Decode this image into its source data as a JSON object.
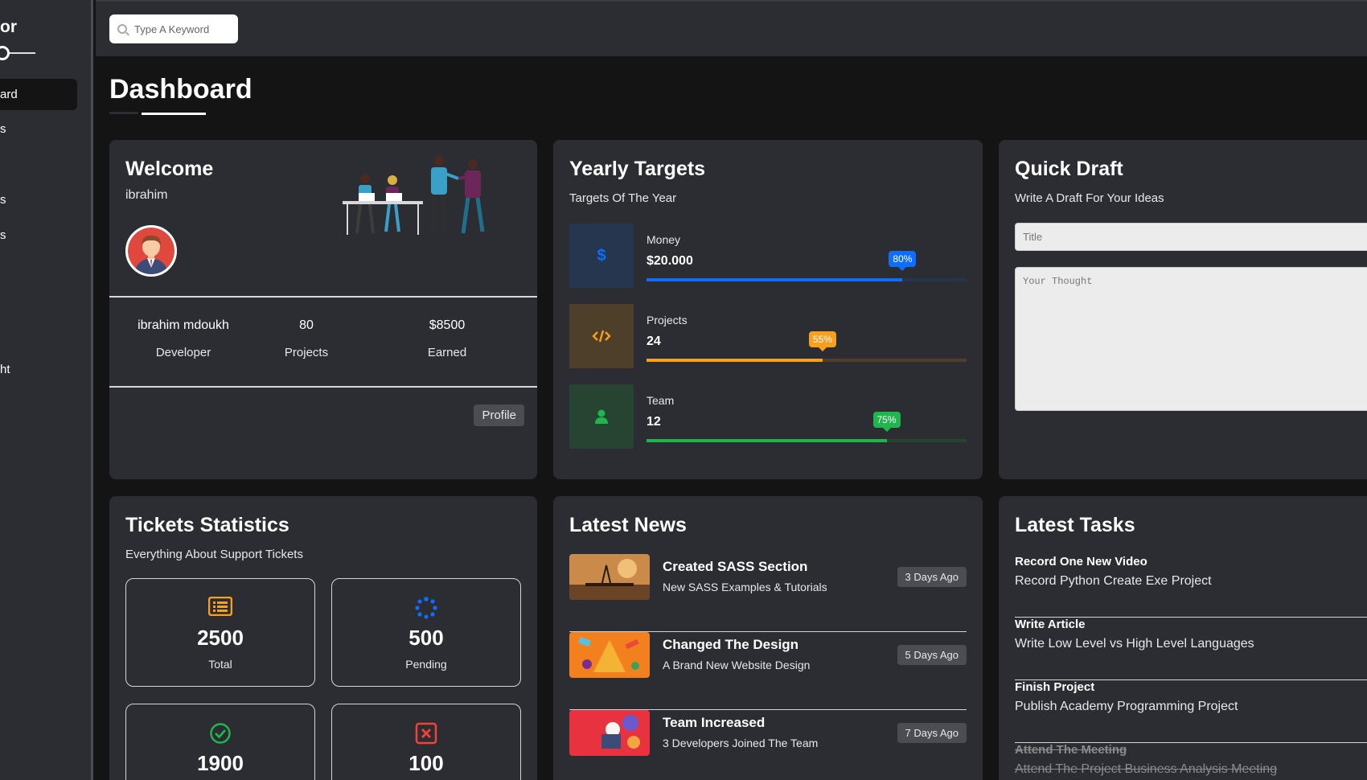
{
  "sidebar": {
    "title": "or",
    "items": [
      {
        "label": "ard"
      },
      {
        "label": "s"
      },
      {
        "label": "s"
      },
      {
        "label": "s"
      },
      {
        "label": "ht"
      }
    ]
  },
  "search": {
    "placeholder": "Type A Keyword"
  },
  "page": {
    "title": "Dashboard"
  },
  "welcome": {
    "title": "Welcome",
    "user": "ibrahim",
    "stats": [
      {
        "value": "ibrahim mdoukh",
        "label": "Developer"
      },
      {
        "value": "80",
        "label": "Projects"
      },
      {
        "value": "$8500",
        "label": "Earned"
      }
    ],
    "profile_button": "Profile"
  },
  "targets": {
    "title": "Yearly Targets",
    "subtitle": "Targets Of The Year",
    "items": [
      {
        "label": "Money",
        "value": "$20.000",
        "percent": 80,
        "percent_label": "80%",
        "icon": "dollar-icon",
        "color": "#0d6efd",
        "bg": "#26364f"
      },
      {
        "label": "Projects",
        "value": "24",
        "percent": 55,
        "percent_label": "55%",
        "icon": "code-icon",
        "color": "#f7a01e",
        "bg": "#4e3f2a"
      },
      {
        "label": "Team",
        "value": "12",
        "percent": 75,
        "percent_label": "75%",
        "icon": "user-icon",
        "color": "#22b54e",
        "bg": "#274433"
      }
    ]
  },
  "draft": {
    "title": "Quick Draft",
    "subtitle": "Write A Draft For Your Ideas",
    "title_placeholder": "Title",
    "body_placeholder": "Your Thought"
  },
  "tickets": {
    "title": "Tickets Statistics",
    "subtitle": "Everything About Support Tickets",
    "items": [
      {
        "value": "2500",
        "label": "Total",
        "icon": "list-icon",
        "color": "#f7a01e"
      },
      {
        "value": "500",
        "label": "Pending",
        "icon": "spinner-icon",
        "color": "#0d6efd"
      },
      {
        "value": "1900",
        "label": "",
        "icon": "check-circle-icon",
        "color": "#22b54e"
      },
      {
        "value": "100",
        "label": "",
        "icon": "close-square-icon",
        "color": "#f44336"
      }
    ]
  },
  "news": {
    "title": "Latest News",
    "items": [
      {
        "title": "Created SASS Section",
        "subtitle": "New SASS Examples & Tutorials",
        "date": "3 Days Ago"
      },
      {
        "title": "Changed The Design",
        "subtitle": "A Brand New Website Design",
        "date": "5 Days Ago"
      },
      {
        "title": "Team Increased",
        "subtitle": "3 Developers Joined The Team",
        "date": "7 Days Ago"
      }
    ]
  },
  "tasks": {
    "title": "Latest Tasks",
    "items": [
      {
        "title": "Record One New Video",
        "subtitle": "Record Python Create Exe Project",
        "done": false
      },
      {
        "title": "Write Article",
        "subtitle": "Write Low Level vs High Level Languages",
        "done": false
      },
      {
        "title": "Finish Project",
        "subtitle": "Publish Academy Programming Project",
        "done": false
      },
      {
        "title": "Attend The Meeting",
        "subtitle": "Attend The Project Business Analysis Meeting",
        "done": true
      }
    ]
  }
}
